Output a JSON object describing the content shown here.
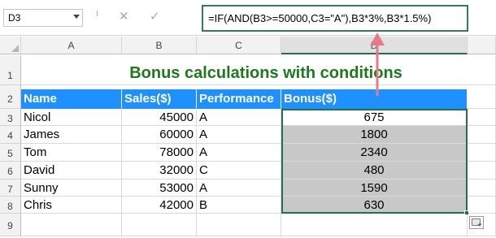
{
  "formula_bar": {
    "name_box": "D3",
    "cancel_icon": "✕",
    "enter_icon": "✓",
    "fx_label": "fx",
    "formula": "=IF(AND(B3>=50000,C3=\"A\"),B3*3%,B3*1.5%)"
  },
  "columns": [
    "A",
    "B",
    "C",
    "D"
  ],
  "rows": [
    "1",
    "2",
    "3",
    "4",
    "5",
    "6",
    "7",
    "8",
    "9"
  ],
  "sheet": {
    "title": "Bonus calculations with conditions",
    "headers": [
      "Name",
      "Sales($)",
      "Performance",
      "Bonus($)"
    ],
    "data": [
      {
        "name": "Nicol",
        "sales": "45000",
        "performance": "A",
        "bonus": "675"
      },
      {
        "name": "James",
        "sales": "60000",
        "performance": "A",
        "bonus": "1800"
      },
      {
        "name": "Tom",
        "sales": "78000",
        "performance": "A",
        "bonus": "2340"
      },
      {
        "name": "David",
        "sales": "32000",
        "performance": "C",
        "bonus": "480"
      },
      {
        "name": "Sunny",
        "sales": "53000",
        "performance": "A",
        "bonus": "1590"
      },
      {
        "name": "Chris",
        "sales": "42000",
        "performance": "B",
        "bonus": "630"
      }
    ]
  },
  "colors": {
    "header_fill": "#1e90ff",
    "title_color": "#1b7b1b",
    "selection_border": "#217346",
    "arrow_color": "#e8788a",
    "result_fill": "#c8c8c8"
  }
}
